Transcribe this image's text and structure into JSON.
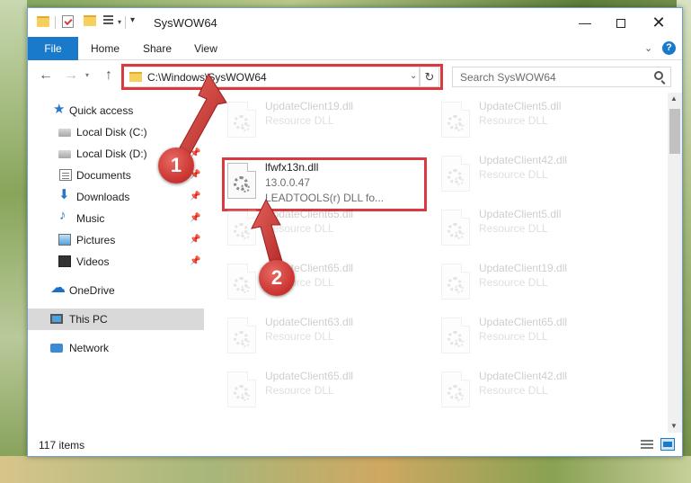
{
  "window": {
    "title": "SysWOW64",
    "controls": {
      "minimize": "—",
      "close": "✕"
    }
  },
  "ribbon": {
    "tabs": [
      "File",
      "Home",
      "Share",
      "View"
    ],
    "help": "?"
  },
  "navigation": {
    "address": "C:\\Windows\\SysWOW64",
    "search_placeholder": "Search SysWOW64"
  },
  "sidebar": {
    "items": [
      {
        "label": "Quick access",
        "icon": "star-icon"
      },
      {
        "label": "Local Disk (C:)",
        "icon": "drive-icon",
        "pinned": true
      },
      {
        "label": "Local Disk (D:)",
        "icon": "drive-icon",
        "pinned": true
      },
      {
        "label": "Documents",
        "icon": "documents-icon",
        "pinned": true
      },
      {
        "label": "Downloads",
        "icon": "download-icon",
        "pinned": true
      },
      {
        "label": "Music",
        "icon": "music-icon",
        "pinned": true
      },
      {
        "label": "Pictures",
        "icon": "pictures-icon",
        "pinned": true
      },
      {
        "label": "Videos",
        "icon": "videos-icon",
        "pinned": true
      },
      {
        "label": "OneDrive",
        "icon": "cloud-icon"
      },
      {
        "label": "This PC",
        "icon": "computer-icon",
        "selected": true
      },
      {
        "label": "Network",
        "icon": "network-icon"
      }
    ]
  },
  "files": {
    "left_column": [
      {
        "name": "UpdateClient19.dll",
        "type": "Resource DLL"
      },
      {
        "name": "lfwfx13n.dll",
        "version": "13.0.0.47",
        "description": "LEADTOOLS(r) DLL fo..."
      },
      {
        "name": "UpdateClient65.dll",
        "type": "Resource DLL"
      },
      {
        "name": "UpdateClient65.dll",
        "type": "Resource DLL"
      },
      {
        "name": "UpdateClient63.dll",
        "type": "Resource DLL"
      },
      {
        "name": "UpdateClient65.dll",
        "type": "Resource DLL"
      }
    ],
    "right_column": [
      {
        "name": "UpdateClient5.dll",
        "type": "Resource DLL"
      },
      {
        "name": "UpdateClient42.dll",
        "type": "Resource DLL"
      },
      {
        "name": "UpdateClient5.dll",
        "type": "Resource DLL"
      },
      {
        "name": "UpdateClient19.dll",
        "type": "Resource DLL"
      },
      {
        "name": "UpdateClient65.dll",
        "type": "Resource DLL"
      },
      {
        "name": "UpdateClient42.dll",
        "type": "Resource DLL"
      }
    ]
  },
  "status": {
    "item_count": "117 items"
  },
  "annotations": {
    "step1": "1",
    "step2": "2",
    "highlight_color": "#d9393f"
  }
}
